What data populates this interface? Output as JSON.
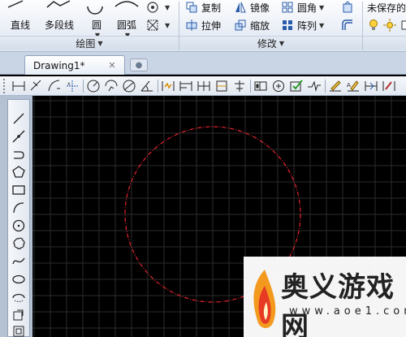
{
  "ribbon": {
    "draw_panel": {
      "title": "绘图",
      "tools": [
        {
          "label": "直线",
          "icon": "line-icon"
        },
        {
          "label": "多段线",
          "icon": "polyline-icon"
        },
        {
          "label": "圆",
          "icon": "circle-icon"
        },
        {
          "label": "圆弧",
          "icon": "arc-icon"
        }
      ]
    },
    "modify_panel": {
      "title": "修改",
      "tools": [
        {
          "label": "复制",
          "icon": "copy-icon"
        },
        {
          "label": "镜像",
          "icon": "mirror-icon"
        },
        {
          "label": "圆角",
          "icon": "fillet-icon"
        },
        {
          "label": "拉伸",
          "icon": "stretch-icon"
        },
        {
          "label": "缩放",
          "icon": "scale-icon"
        },
        {
          "label": "阵列",
          "icon": "array-icon"
        }
      ]
    },
    "layer_panel": {
      "state": "未保存的"
    }
  },
  "tabs": {
    "document": "Drawing1*"
  },
  "canvas": {
    "background": "#000000",
    "grid_color": "#2b2b2b",
    "circle_color": "#e8242f"
  },
  "watermark": {
    "text": "奥义游戏网",
    "url": "www.aoe1.com"
  }
}
